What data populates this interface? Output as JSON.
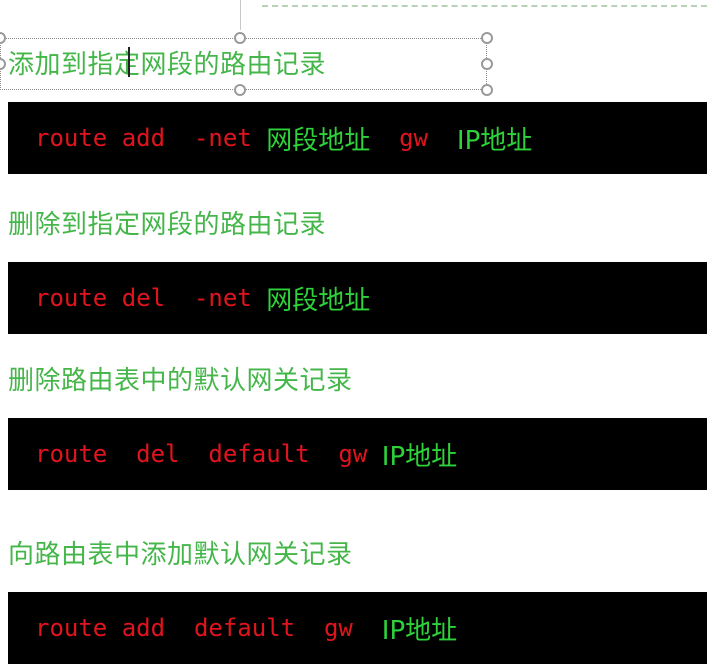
{
  "sections": [
    {
      "heading": "添加到指定网段的路由记录",
      "command": [
        {
          "text": "route add  -net ",
          "color": "red"
        },
        {
          "text": "网段地址",
          "color": "green"
        },
        {
          "text": "  gw  ",
          "color": "red"
        },
        {
          "text": "IP地址",
          "color": "green"
        }
      ]
    },
    {
      "heading": "删除到指定网段的路由记录",
      "command": [
        {
          "text": "route del  -net ",
          "color": "red"
        },
        {
          "text": "网段地址",
          "color": "green"
        }
      ]
    },
    {
      "heading": "删除路由表中的默认网关记录",
      "command": [
        {
          "text": "route  del  default  gw ",
          "color": "red"
        },
        {
          "text": "IP地址",
          "color": "green"
        }
      ]
    },
    {
      "heading": "向路由表中添加默认网关记录",
      "command": [
        {
          "text": "route add  default  gw  ",
          "color": "red"
        },
        {
          "text": "IP地址",
          "color": "green"
        }
      ]
    }
  ],
  "colors": {
    "heading": "#45b64a",
    "command_red": "#e0141e",
    "command_green": "#2ed23a",
    "block_background": "#000000"
  }
}
